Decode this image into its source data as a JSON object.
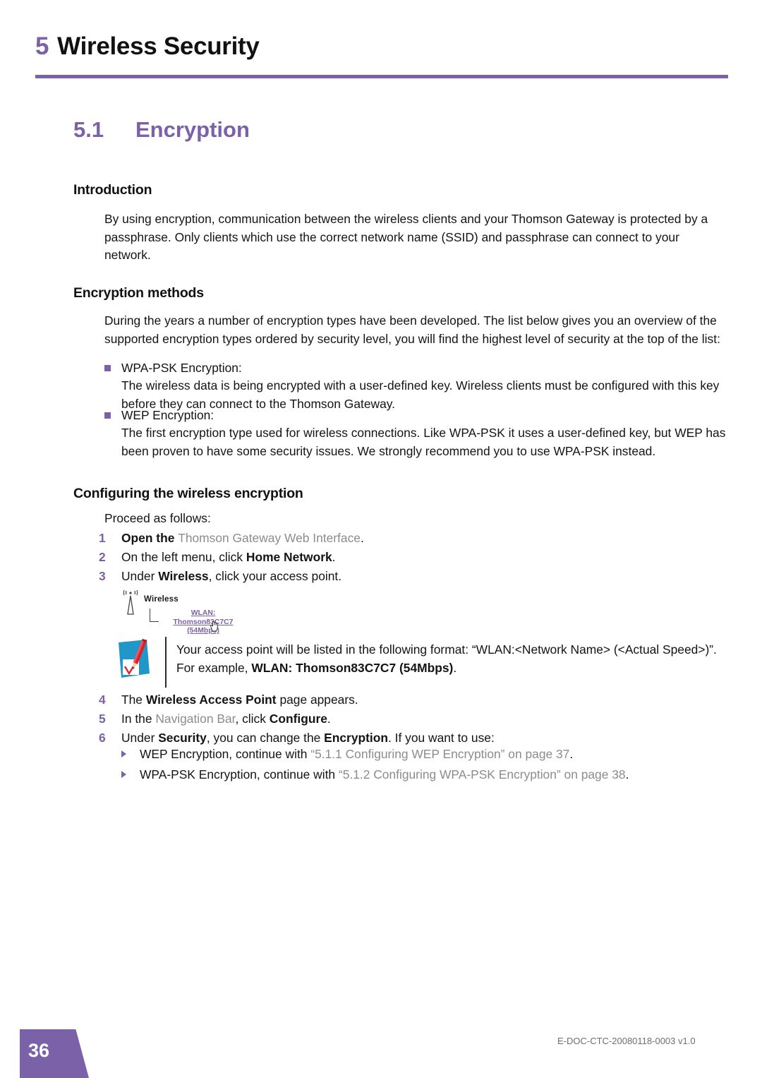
{
  "chapter": {
    "number": "5",
    "title": "Wireless Security"
  },
  "section": {
    "number": "5.1",
    "title": "Encryption"
  },
  "introduction": {
    "heading": "Introduction",
    "paragraph": "By using encryption, communication between the wireless clients and your Thomson Gateway is protected by a passphrase. Only clients which use the correct network name (SSID) and passphrase can connect to your network."
  },
  "encryption_methods": {
    "heading": "Encryption methods",
    "paragraph": "During the years a number of encryption types have been developed. The list below gives you an overview of the supported encryption types ordered by security level, you will find the highest level of security at the top of the list:",
    "items": [
      {
        "title": "WPA-PSK Encryption:",
        "body": "The wireless data is being encrypted with a user-defined key. Wireless clients must be configured with this key before they can connect to the Thomson Gateway."
      },
      {
        "title": "WEP Encryption:",
        "body": "The first encryption type used for wireless connections. Like WPA-PSK it uses a user-defined key, but WEP has been proven to have some security issues. We strongly recommend you to use WPA-PSK instead."
      }
    ]
  },
  "configuring": {
    "heading": "Configuring the wireless encryption",
    "lead": "Proceed as follows:",
    "steps": [
      {
        "number": "1",
        "pre_bold": "Open the ",
        "xref": "Thomson Gateway Web Interface",
        "post": "."
      },
      {
        "number": "2",
        "pre": "On the left menu, click ",
        "bold": "Home Network",
        "post": "."
      },
      {
        "number": "3",
        "pre": "Under ",
        "bold": "Wireless",
        "post": ", click your access point."
      },
      {
        "number": "4",
        "pre": "The ",
        "bold": "Wireless Access Point",
        "post": " page appears."
      },
      {
        "number": "5",
        "pre": "In the ",
        "xref": "Navigation Bar",
        "post2": ", click ",
        "bold": "Configure",
        "post": "."
      },
      {
        "number": "6",
        "pre": "Under ",
        "bold": "Security",
        "mid": ", you can change the ",
        "bold2": "Encryption",
        "post": ". If you want to use:"
      }
    ],
    "subitems": [
      {
        "text": "WEP Encryption, continue with ",
        "xref": "“5.1.1 Configuring WEP Encryption” on page 37",
        "post": "."
      },
      {
        "text": "WPA-PSK Encryption, continue with ",
        "xref": "“5.1.2 Configuring WPA-PSK Encryption” on page 38",
        "post": "."
      }
    ]
  },
  "ui_screenshot": {
    "antenna_icon": "wireless-antenna-icon",
    "wireless_label": "Wireless",
    "wlan_link_line1": "WLAN: Thomson83C7C7",
    "wlan_link_line2": "(54Mbps)",
    "cursor_icon": "hand-cursor-icon"
  },
  "note": {
    "icon": "note-pencil-checkmark-icon",
    "text_part1": "Your access point will be listed in the following format: “WLAN:<Network Name> (<Actual Speed>)”. For example, ",
    "text_bold": "WLAN: Thomson83C7C7 (54Mbps)",
    "text_part2": "."
  },
  "footer": {
    "page_number": "36",
    "doc_reference": "E-DOC-CTC-20080118-0003 v1.0"
  },
  "colors": {
    "accent_purple": "#7B61A8",
    "xref_gray": "#8c8c8c",
    "note_icon_blue": "#2196c9",
    "note_icon_red": "#e0262b"
  }
}
